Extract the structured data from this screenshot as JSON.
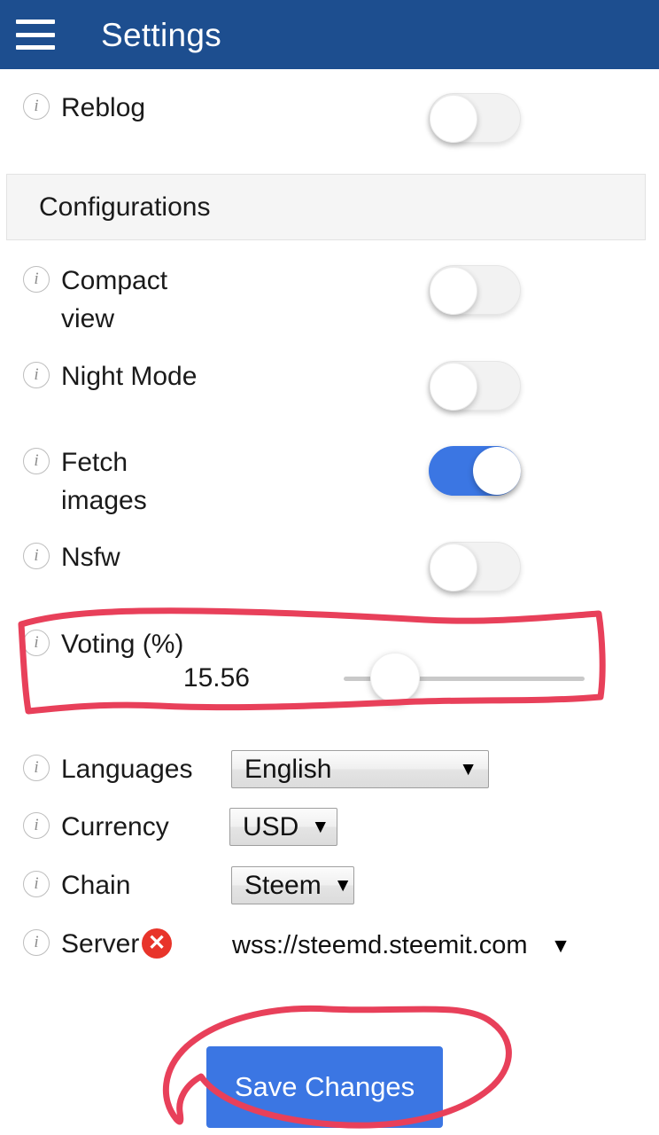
{
  "header": {
    "title": "Settings",
    "menu_icon": "hamburger-menu-icon",
    "background_color": "#1d4e8f"
  },
  "theme": {
    "accent_blue": "#3b76e3",
    "header_blue": "#1d4e8f",
    "error_red": "#e8342a",
    "annotation_red": "#e8405a",
    "panel_gray": "#f5f5f5"
  },
  "settings": {
    "reblog": {
      "label": "Reblog",
      "info_icon": "info-icon",
      "toggle_state": "off"
    },
    "section_title": "Configurations",
    "compact_view": {
      "label": "Compact\nview",
      "info_icon": "info-icon",
      "toggle_state": "off"
    },
    "night_mode": {
      "label": "Night Mode",
      "info_icon": "info-icon",
      "toggle_state": "off"
    },
    "fetch_images": {
      "label": "Fetch\nimages",
      "info_icon": "info-icon",
      "toggle_state": "on"
    },
    "nsfw": {
      "label": "Nsfw",
      "info_icon": "info-icon",
      "toggle_state": "off"
    },
    "voting": {
      "label": "Voting (%)",
      "info_icon": "info-icon",
      "value": "15.56",
      "slider_min": 0,
      "slider_max": 100,
      "slider_percent": 16
    },
    "languages": {
      "label": "Languages",
      "info_icon": "info-icon",
      "selected": "English",
      "caret": "▼"
    },
    "currency": {
      "label": "Currency",
      "info_icon": "info-icon",
      "selected": "USD",
      "caret": "▼"
    },
    "chain": {
      "label": "Chain",
      "info_icon": "info-icon",
      "selected": "Steem",
      "caret": "▼"
    },
    "server": {
      "label": "Server",
      "info_icon": "info-icon",
      "status_icon": "error-x-icon",
      "status_glyph": "✕",
      "selected": "wss://steemd.steemit.com",
      "caret": "▼"
    }
  },
  "actions": {
    "save_label": "Save Changes"
  },
  "annotations": {
    "voting_row_highlight": "hand-drawn red rectangle around Voting row",
    "save_button_highlight": "hand-drawn red ellipse around Save Changes button"
  }
}
